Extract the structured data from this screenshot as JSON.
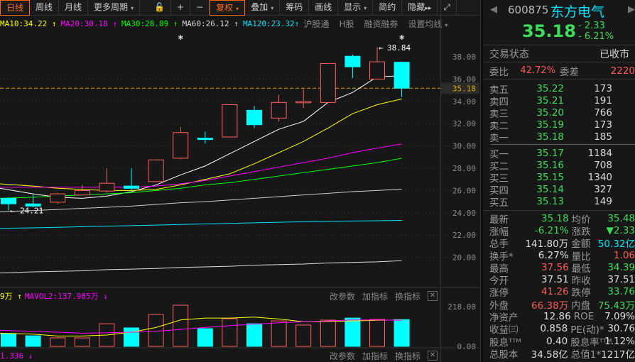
{
  "toolbar": {
    "tabs": [
      "日线",
      "周线",
      "月线",
      "更多周期"
    ],
    "more_caret": "▾",
    "icons": [
      "unlock-icon",
      "zoom-in-icon",
      "zoom-out-icon"
    ],
    "icon_glyphs": [
      "🔓",
      "+",
      "−"
    ],
    "buttons": [
      "复权",
      "叠加",
      "筹码",
      "画线",
      "显示",
      "简约",
      "隐藏"
    ],
    "expand": "⤢",
    "hide_arrows": "▸▸"
  },
  "ma_bar": {
    "items": [
      {
        "label": "MA10:34.22",
        "arrow": "↑",
        "color": "#ffff00"
      },
      {
        "label": "MA20:30.18",
        "arrow": "↑",
        "color": "#ff00ff"
      },
      {
        "label": "MA30:28.89",
        "arrow": "↑",
        "color": "#00ff00"
      },
      {
        "label": "MA60:26.12",
        "arrow": "↑",
        "color": "#dddddd"
      },
      {
        "label": "MA120:23.32",
        "arrow": "↑",
        "color": "#00e5ff"
      }
    ],
    "links": [
      "沪股通",
      "H股",
      "融资融券",
      "设置均线"
    ],
    "caret": "▾"
  },
  "price_chart": {
    "high_label": "38.84",
    "low_label": "24.21",
    "current": "35.18",
    "marker": "✱"
  },
  "volume_panel": {
    "ma1_tail": "9万",
    "ma1_arrow": "↑",
    "ma2": "MAVOL2:137.985万",
    "ma2_arrow": "↓",
    "actions": [
      "改参数",
      "加指标",
      "换指标"
    ],
    "close": "✕",
    "axis": [
      "218.00",
      "0.00"
    ]
  },
  "bottom_panel": {
    "value": "1.336",
    "arrow": "↓",
    "actions": [
      "改参数",
      "加指标",
      "换指标"
    ],
    "close": "✕"
  },
  "chart_data": {
    "type": "candlestick",
    "price_axis": {
      "ticks": [
        "38.00",
        "36.00",
        "34.00",
        "32.00",
        "30.00",
        "28.00",
        "26.00",
        "24.00",
        "22.00",
        "20.00"
      ],
      "ylim": [
        18.5,
        40.5
      ]
    },
    "candles": [
      [
        25.3,
        25.4,
        24.21,
        24.8
      ],
      [
        24.8,
        25.7,
        24.5,
        24.6
      ],
      [
        24.95,
        25.8,
        24.8,
        25.7
      ],
      [
        25.6,
        26.5,
        25.6,
        26.0
      ],
      [
        25.95,
        28.0,
        25.8,
        26.65
      ],
      [
        26.4,
        28.0,
        26.0,
        26.2
      ],
      [
        26.8,
        28.8,
        26.75,
        28.75
      ],
      [
        28.9,
        31.7,
        28.8,
        31.2
      ],
      [
        30.7,
        31.3,
        30.2,
        30.6
      ],
      [
        30.8,
        33.7,
        30.8,
        33.7
      ],
      [
        33.2,
        33.6,
        31.6,
        31.9
      ],
      [
        32.5,
        34.6,
        32.2,
        33.9
      ],
      [
        34.0,
        35.1,
        33.4,
        34.0
      ],
      [
        33.9,
        37.4,
        33.9,
        37.4
      ],
      [
        38.05,
        38.2,
        36.1,
        37.1
      ],
      [
        36.0,
        38.84,
        36.0,
        37.55
      ],
      [
        37.51,
        37.56,
        34.39,
        35.18
      ]
    ],
    "candle_fields": [
      "open",
      "high",
      "low",
      "close"
    ],
    "ma_lines": [
      {
        "name": "MA5",
        "color": "#ffffff",
        "values": [
          26.2,
          25.7,
          25.4,
          25.3,
          25.5,
          25.9,
          26.5,
          27.4,
          28.2,
          29.3,
          30.4,
          31.5,
          32.2,
          33.9,
          34.8,
          36.2,
          36.3
        ]
      },
      {
        "name": "MA10",
        "color": "#ffff00",
        "values": [
          26.6,
          26.4,
          26.2,
          26.1,
          26.0,
          26.0,
          26.1,
          26.5,
          27.0,
          27.5,
          28.4,
          29.4,
          30.4,
          31.6,
          32.9,
          33.7,
          34.22
        ]
      },
      {
        "name": "MA20",
        "color": "#ff00ff",
        "values": [
          26.3,
          26.3,
          26.3,
          26.3,
          26.3,
          26.3,
          26.4,
          26.6,
          26.9,
          27.3,
          27.7,
          28.1,
          28.5,
          28.9,
          29.4,
          29.8,
          30.18
        ]
      },
      {
        "name": "MA30",
        "color": "#00ff00",
        "values": [
          25.3,
          25.4,
          25.5,
          25.6,
          25.7,
          25.8,
          26.0,
          26.2,
          26.5,
          26.7,
          27.0,
          27.3,
          27.6,
          27.9,
          28.2,
          28.5,
          28.89
        ]
      },
      {
        "name": "MA60",
        "color": "#cccccc",
        "values": [
          24.1,
          24.2,
          24.3,
          24.4,
          24.5,
          24.6,
          24.75,
          24.9,
          25.0,
          25.15,
          25.3,
          25.45,
          25.6,
          25.75,
          25.9,
          26.0,
          26.12
        ]
      },
      {
        "name": "MA120",
        "color": "#00e5ff",
        "values": [
          22.6,
          22.65,
          22.7,
          22.75,
          22.8,
          22.85,
          22.9,
          22.95,
          23.0,
          23.05,
          23.1,
          23.15,
          23.2,
          23.22,
          23.26,
          23.29,
          23.32
        ]
      },
      {
        "name": "MA250",
        "color": "#dddddd",
        "values": [
          18.6,
          18.7,
          18.75,
          18.8,
          18.9,
          18.95,
          19.0,
          19.1,
          19.15,
          19.2,
          19.3,
          19.35,
          19.4,
          19.5,
          19.55,
          19.6,
          19.7
        ]
      }
    ],
    "volume": {
      "unit": "万",
      "ylim": [
        0,
        218
      ],
      "values": [
        68,
        56,
        45,
        45,
        120,
        98,
        169,
        218,
        94,
        147,
        120,
        135,
        113,
        139,
        150,
        143,
        141.8
      ],
      "ma": [
        {
          "name": "MAVOL1",
          "color": "#ffff00",
          "values": [
            70,
            65,
            55,
            55,
            60,
            75,
            100,
            140,
            150,
            150,
            155,
            145,
            130,
            132,
            135,
            138,
            140
          ]
        },
        {
          "name": "MAVOL2",
          "color": "#ff00ff",
          "values": [
            85,
            80,
            75,
            70,
            72,
            75,
            80,
            90,
            100,
            110,
            118,
            125,
            130,
            135,
            140,
            140,
            137.985
          ]
        }
      ]
    },
    "up_color": "#ff5f5f",
    "down_color": "#00ffff"
  },
  "quote": {
    "code": "600875",
    "name": "东方电气",
    "price": "35.18",
    "change": "- 2.33",
    "change_pct": "- 6.21%",
    "status_label": "交易状态",
    "status": "已收市",
    "weibi_label": "委比",
    "weibi": "42.72%",
    "weicha_label": "委差",
    "weicha": "2220",
    "asks": [
      {
        "l": "卖五",
        "p": "35.22",
        "v": "173"
      },
      {
        "l": "卖四",
        "p": "35.21",
        "v": "191"
      },
      {
        "l": "卖三",
        "p": "35.20",
        "v": "766"
      },
      {
        "l": "卖二",
        "p": "35.19",
        "v": "173"
      },
      {
        "l": "卖一",
        "p": "35.18",
        "v": "185"
      }
    ],
    "bids": [
      {
        "l": "买一",
        "p": "35.17",
        "v": "1184"
      },
      {
        "l": "买二",
        "p": "35.16",
        "v": "708"
      },
      {
        "l": "买三",
        "p": "35.15",
        "v": "1340"
      },
      {
        "l": "买四",
        "p": "35.14",
        "v": "327"
      },
      {
        "l": "买五",
        "p": "35.13",
        "v": "149"
      }
    ],
    "stats": [
      [
        "最新",
        "35.18",
        "g",
        "均价",
        "35.48",
        "g"
      ],
      [
        "涨幅",
        "-6.21%",
        "g",
        "涨跌",
        "▼2.33",
        "g"
      ],
      [
        "总手",
        "141.80万",
        "w",
        "金额",
        "50.32亿",
        "cy"
      ],
      [
        "换手*",
        "6.27%",
        "w",
        "量比",
        "1.06",
        "rd"
      ],
      [
        "最高",
        "37.56",
        "rd",
        "最低",
        "34.39",
        "g"
      ],
      [
        "今开",
        "37.51",
        "w",
        "昨收",
        "37.51",
        "w"
      ],
      [
        "涨停",
        "41.26",
        "rd",
        "跌停",
        "33.76",
        "g"
      ],
      [
        "外盘",
        "66.38万",
        "rd",
        "内盘",
        "75.43万",
        "g"
      ],
      [
        "净资产",
        "12.86",
        "w",
        "ROE",
        "7.09%",
        "w"
      ],
      [
        "收益㈢",
        "0.858",
        "w",
        "PE(动)*",
        "30.76",
        "w"
      ],
      [
        "股息ᵀᵀᴹ",
        "0.40",
        "w",
        "股息率ᵀᵀᴹ",
        "1.12%",
        "w"
      ],
      [
        "总股本",
        "34.58亿",
        "w",
        "总值1*",
        "1217亿",
        "w"
      ]
    ]
  }
}
